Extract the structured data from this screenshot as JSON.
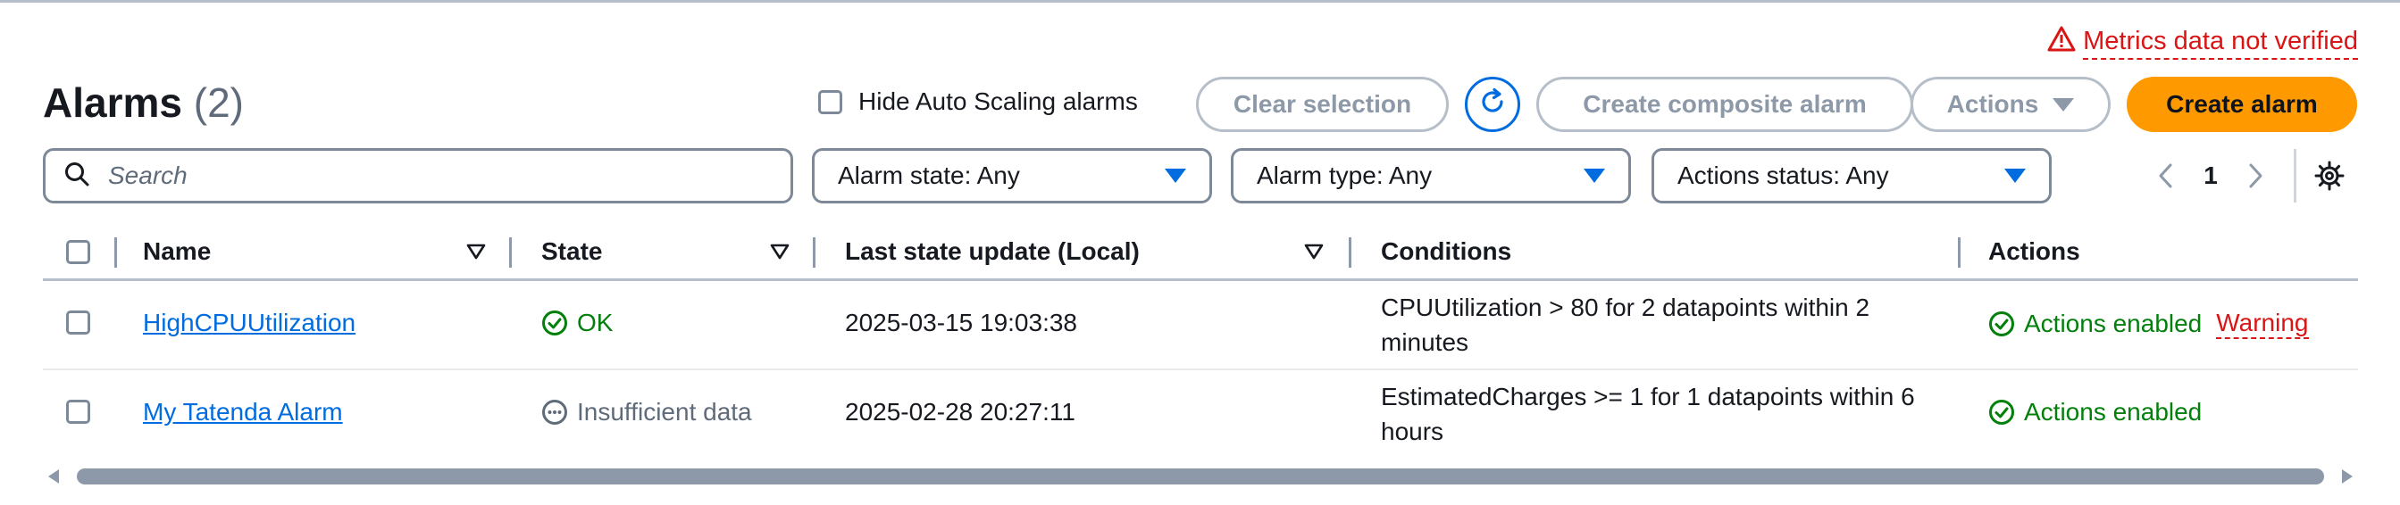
{
  "warning": {
    "text": "Metrics data not verified",
    "icon": "warning-icon",
    "color": "#d91515"
  },
  "header": {
    "title": "Alarms",
    "count": "(2)"
  },
  "options": {
    "hide_autoscaling_label": "Hide Auto Scaling alarms",
    "hide_autoscaling_checked": false
  },
  "buttons": {
    "clear_selection": "Clear selection",
    "refresh_icon": "refresh-icon",
    "create_composite": "Create composite alarm",
    "actions": "Actions",
    "create_alarm": "Create alarm"
  },
  "colors": {
    "primary": "#ff9900",
    "accent": "#006ce0",
    "ok": "#037f0c",
    "error": "#d91515",
    "disabled": "#8d99a8"
  },
  "filters": {
    "search_placeholder": "Search",
    "alarm_state": "Alarm state: Any",
    "alarm_type": "Alarm type: Any",
    "actions_status": "Actions status: Any"
  },
  "pagination": {
    "current_page": "1"
  },
  "table": {
    "columns": [
      "Name",
      "State",
      "Last state update (Local)",
      "Conditions",
      "Actions"
    ],
    "rows": [
      {
        "name": "HighCPUUtilization",
        "state": "OK",
        "state_icon": "check-circle-icon",
        "last_update": "2025-03-15 19:03:38",
        "conditions": "CPUUtilization > 80 for 2 datapoints within 2 minutes",
        "actions": "Actions enabled",
        "extra": "Warning"
      },
      {
        "name": "My Tatenda Alarm",
        "state": "Insufficient data",
        "state_icon": "ellipsis-circle-icon",
        "last_update": "2025-02-28 20:27:11",
        "conditions": "EstimatedCharges >= 1 for 1 datapoints within 6 hours",
        "actions": "Actions enabled",
        "extra": ""
      }
    ]
  }
}
